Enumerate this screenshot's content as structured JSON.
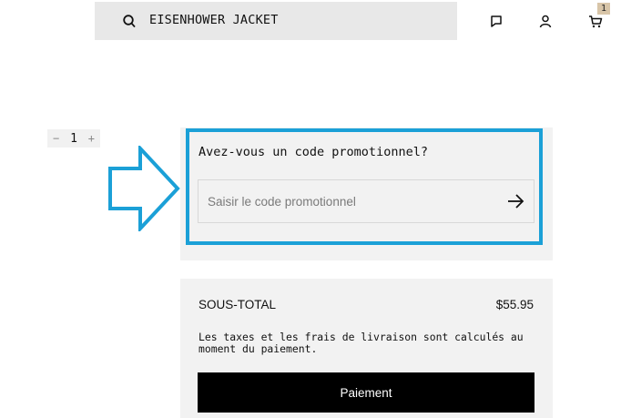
{
  "header": {
    "search_text": "EISENHOWER JACKET",
    "icons": [
      "search-icon",
      "chat-icon",
      "user-icon",
      "cart-icon"
    ],
    "cart_count": "1"
  },
  "quantity": {
    "minus": "−",
    "value": "1",
    "plus": "+"
  },
  "promo": {
    "title": "Avez-vous un code promotionnel?",
    "placeholder": "Saisir le code promotionnel",
    "value": "",
    "highlight_color": "#1ba0d7"
  },
  "summary": {
    "subtotal_label": "SOUS-TOTAL",
    "subtotal_value": "$55.95",
    "tax_note": "Les taxes et les frais de livraison sont calculés au moment du paiement.",
    "checkout_label": "Paiement"
  },
  "colors": {
    "accent": "#1ba0d7",
    "panel": "#f2f2f2",
    "badge": "#d8c5a8"
  }
}
